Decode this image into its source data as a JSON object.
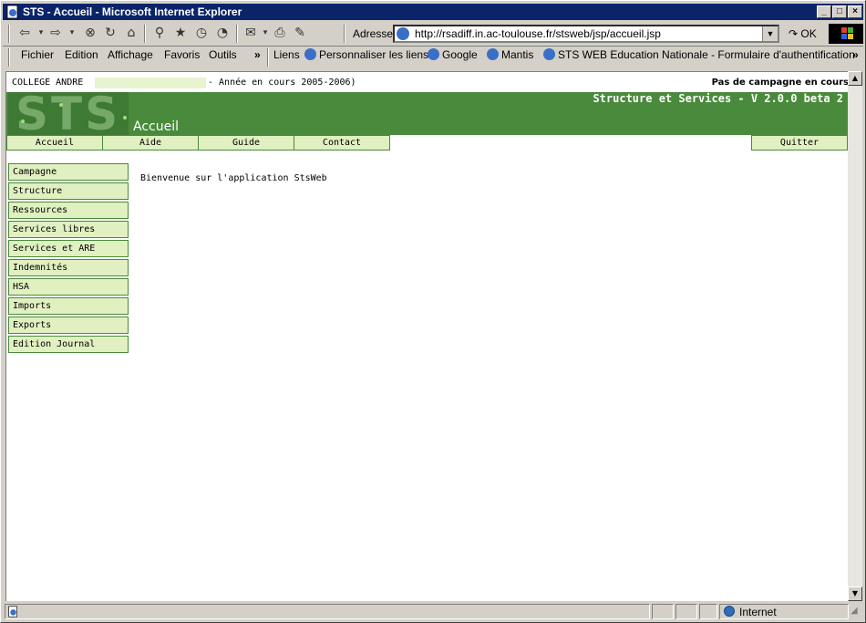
{
  "window": {
    "title": "STS - Accueil - Microsoft Internet Explorer",
    "controls": {
      "minimize": "_",
      "maximize": "□",
      "close": "×"
    }
  },
  "toolbar": {
    "address_label": "Adresse",
    "address_url": "http://rsadiff.in.ac-toulouse.fr/stsweb/jsp/accueil.jsp",
    "go_label": "OK",
    "icons": [
      "back-icon",
      "forward-icon",
      "stop-icon",
      "refresh-icon",
      "home-icon",
      "search-icon",
      "favorites-icon",
      "history-icon",
      "media-icon",
      "mail-icon",
      "print-icon",
      "edit-icon"
    ]
  },
  "menubar": {
    "items": [
      "Fichier",
      "Edition",
      "Affichage",
      "Favoris",
      "Outils"
    ],
    "more": "»",
    "links_label": "Liens",
    "links": [
      "Personnaliser les liens",
      "Google",
      "Mantis",
      "STS WEB Education Nationale - Formulaire d'authentification"
    ],
    "links_more": "»"
  },
  "page": {
    "college": "COLLEGE ANDRE",
    "year": "- Année en cours 2005-2006)",
    "campaign_status": "Pas de campagne en cours",
    "logo_text": "STS",
    "app_title": "Structure et Services - V 2.0.0 beta 2",
    "section_title": "Accueil",
    "nav": [
      "Accueil",
      "Aide",
      "Guide",
      "Contact"
    ],
    "quit": "Quitter",
    "side_menu": [
      "Campagne",
      "Structure",
      "Ressources",
      "Services libres",
      "Services et ARE",
      "Indemnités",
      "HSA",
      "Imports",
      "Exports",
      "Edition Journal"
    ],
    "welcome": "Bienvenue sur l'application StsWeb"
  },
  "status": {
    "zone": "Internet"
  },
  "colors": {
    "banner_green": "#4a8a3c",
    "button_fill": "#e0f0c0",
    "titlebar": "#0a246a"
  }
}
